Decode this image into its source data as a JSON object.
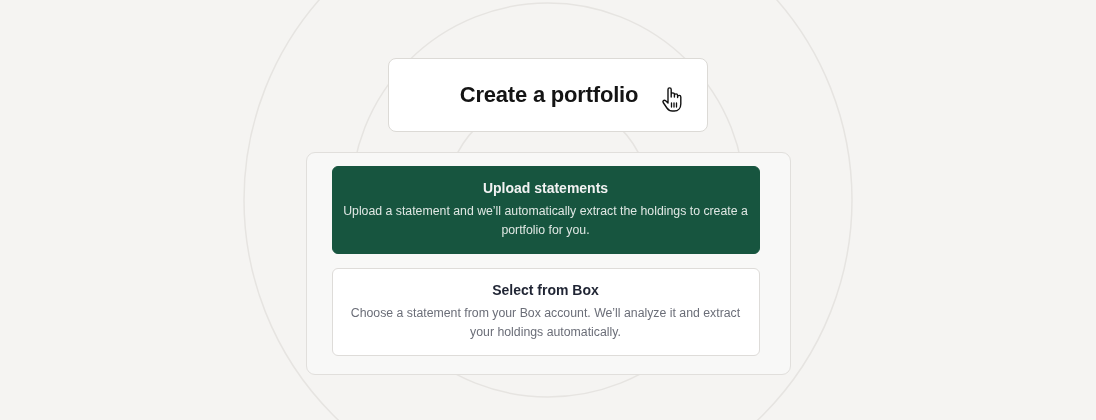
{
  "create_button": {
    "label": "Create a portfolio"
  },
  "options": [
    {
      "title": "Upload statements",
      "description": "Upload a statement and we’ll automatically extract the holdings to create a portfolio for you.",
      "selected": true
    },
    {
      "title": "Select from Box",
      "description": "Choose a statement from your Box account. We’ll analyze it and extract your holdings automatically.",
      "selected": false
    }
  ]
}
